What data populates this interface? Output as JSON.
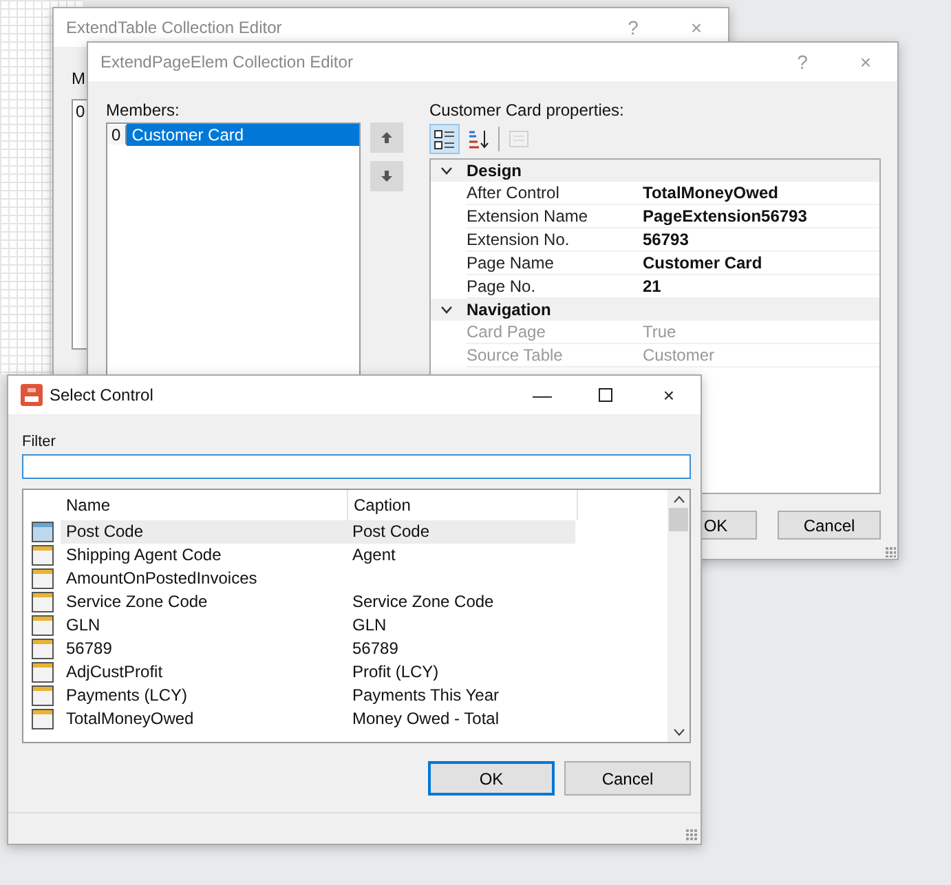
{
  "back_window": {
    "title": "ExtendTable Collection Editor",
    "help": "?",
    "close": "×",
    "members_label": "M",
    "member_index": "0"
  },
  "editor_window": {
    "title": "ExtendPageElem Collection Editor",
    "help": "?",
    "close": "×",
    "members_label": "Members:",
    "members": [
      {
        "index": "0",
        "name": "Customer Card",
        "selected": true
      }
    ],
    "properties_label": "Customer Card properties:",
    "toolbar": [
      {
        "kind": "categorized",
        "selected": true,
        "disabled": false
      },
      {
        "kind": "alphabetical",
        "selected": false,
        "disabled": false
      },
      {
        "kind": "property-pages",
        "selected": false,
        "disabled": true
      }
    ],
    "categories": [
      {
        "name": "Design",
        "expanded": true,
        "properties": [
          {
            "name": "After Control",
            "value": "TotalMoneyOwed",
            "readonly": false
          },
          {
            "name": "Extension Name",
            "value": "PageExtension56793",
            "readonly": false
          },
          {
            "name": "Extension No.",
            "value": "56793",
            "readonly": false
          },
          {
            "name": "Page Name",
            "value": "Customer Card",
            "readonly": false
          },
          {
            "name": "Page No.",
            "value": "21",
            "readonly": false
          }
        ]
      },
      {
        "name": "Navigation",
        "expanded": true,
        "properties": [
          {
            "name": "Card Page",
            "value": "True",
            "readonly": true
          },
          {
            "name": "Source Table",
            "value": "Customer",
            "readonly": true
          }
        ]
      }
    ],
    "buttons": [
      "OK",
      "Cancel"
    ]
  },
  "select_window": {
    "title": "Select Control",
    "minimize": "—",
    "close": "×",
    "filter_label": "Filter",
    "columns": [
      "Name",
      "Caption"
    ],
    "rows": [
      {
        "name": "Post Code",
        "caption": "Post Code",
        "selected": true
      },
      {
        "name": "Shipping Agent Code",
        "caption": "Agent",
        "selected": false
      },
      {
        "name": "AmountOnPostedInvoices",
        "selected": false
      },
      {
        "name": "Service Zone Code",
        "caption": "Service Zone Code",
        "selected": false
      },
      {
        "name": "GLN",
        "caption": "GLN",
        "selected": false
      },
      {
        "name": "56789",
        "caption": "56789",
        "selected": false
      },
      {
        "name": "AdjCustProfit",
        "caption": "Profit (LCY)",
        "selected": false
      },
      {
        "name": "Payments (LCY)",
        "caption": "Payments This Year",
        "selected": false
      },
      {
        "name": "TotalMoneyOwed",
        "caption": "Money Owed - Total",
        "selected": false
      }
    ],
    "buttons": [
      {
        "label": "OK",
        "focused": true
      },
      {
        "label": "Cancel",
        "focused": false
      }
    ]
  }
}
